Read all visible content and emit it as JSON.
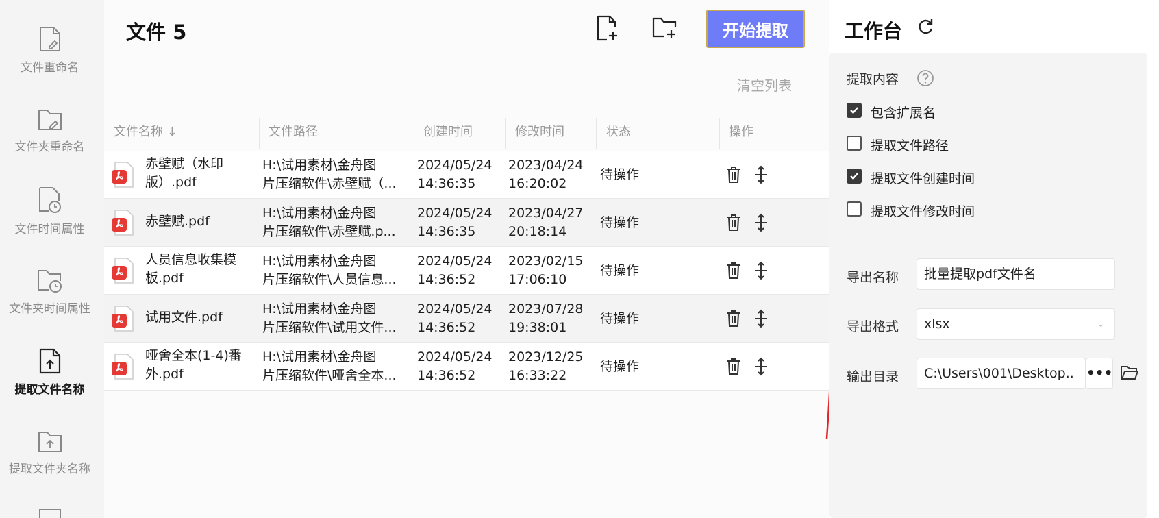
{
  "sidebar": {
    "items": [
      {
        "label": "文件重命名",
        "icon": "file-edit-icon"
      },
      {
        "label": "文件夹重命名",
        "icon": "folder-edit-icon"
      },
      {
        "label": "文件时间属性",
        "icon": "file-clock-icon"
      },
      {
        "label": "文件夹时间属性",
        "icon": "folder-clock-icon"
      },
      {
        "label": "提取文件名称",
        "icon": "file-upload-icon",
        "active": true
      },
      {
        "label": "提取文件夹名称",
        "icon": "folder-upload-icon"
      }
    ]
  },
  "main": {
    "title": "文件 5",
    "add_file_icon": "add-file-icon",
    "add_folder_icon": "add-folder-icon",
    "start_button": "开始提取",
    "clear_list": "清空列表",
    "columns": [
      "文件名称 ↓",
      "文件路径",
      "创建时间",
      "修改时间",
      "状态",
      "操作"
    ],
    "rows": [
      {
        "name": "赤壁赋（水印版）.pdf",
        "path1": "H:\\试用素材\\金舟图",
        "path2": "片压缩软件\\赤壁赋（...",
        "created1": "2024/05/24",
        "created2": "14:36:35",
        "modified1": "2023/04/24",
        "modified2": "16:20:02",
        "status": "待操作"
      },
      {
        "name": "赤壁赋.pdf",
        "path1": "H:\\试用素材\\金舟图",
        "path2": "片压缩软件\\赤壁赋.p...",
        "created1": "2024/05/24",
        "created2": "14:36:35",
        "modified1": "2023/04/27",
        "modified2": "20:18:14",
        "status": "待操作"
      },
      {
        "name": "人员信息收集模板.pdf",
        "path1": "H:\\试用素材\\金舟图",
        "path2": "片压缩软件\\人员信息...",
        "created1": "2024/05/24",
        "created2": "14:36:52",
        "modified1": "2023/02/15",
        "modified2": "17:06:10",
        "status": "待操作"
      },
      {
        "name": "试用文件.pdf",
        "path1": "H:\\试用素材\\金舟图",
        "path2": "片压缩软件\\试用文件...",
        "created1": "2024/05/24",
        "created2": "14:36:52",
        "modified1": "2023/07/28",
        "modified2": "19:38:01",
        "status": "待操作"
      },
      {
        "name": "哑舍全本(1-4)番外.pdf",
        "path1": "H:\\试用素材\\金舟图",
        "path2": "片压缩软件\\哑舍全本...",
        "created1": "2024/05/24",
        "created2": "14:36:52",
        "modified1": "2023/12/25",
        "modified2": "16:33:22",
        "status": "待操作"
      }
    ]
  },
  "workspace": {
    "title": "工作台",
    "extract_label": "提取内容",
    "options": [
      {
        "label": "包含扩展名",
        "checked": true
      },
      {
        "label": "提取文件路径",
        "checked": false
      },
      {
        "label": "提取文件创建时间",
        "checked": true
      },
      {
        "label": "提取文件修改时间",
        "checked": false
      }
    ],
    "export_name_label": "导出名称",
    "export_name_value": "批量提取pdf文件名",
    "export_format_label": "导出格式",
    "export_format_value": "xlsx",
    "output_dir_label": "输出目录",
    "output_dir_value": "C:\\Users\\001\\Desktop..",
    "more_label": "•••"
  },
  "colors": {
    "accent": "#6f7cf8",
    "pdf_red": "#e53935",
    "annotation": "#e0262b"
  }
}
